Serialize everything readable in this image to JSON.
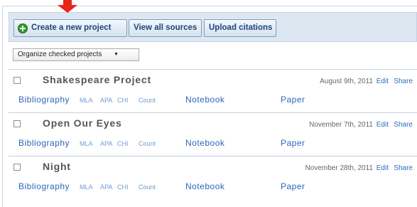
{
  "toolbar": {
    "create_label": "Create a new project",
    "view_label": "View all sources",
    "upload_label": "Upload citations"
  },
  "organize": {
    "selected": "Organize checked projects"
  },
  "projects": [
    {
      "title": "Shakespeare Project",
      "date": "August 9th, 2011",
      "edit": "Edit",
      "share": "Share",
      "bibliography": "Bibliography",
      "mla": "MLA",
      "apa": "APA",
      "chi": "CHI",
      "count": "Count",
      "notebook": "Notebook",
      "paper": "Paper"
    },
    {
      "title": "Open Our Eyes",
      "date": "November 7th, 2011",
      "edit": "Edit",
      "share": "Share",
      "bibliography": "Bibliography",
      "mla": "MLA",
      "apa": "APA",
      "chi": "CHI",
      "count": "Count",
      "notebook": "Notebook",
      "paper": "Paper"
    },
    {
      "title": "Night",
      "date": "November 28th, 2011",
      "edit": "Edit",
      "share": "Share",
      "bibliography": "Bibliography",
      "mla": "MLA",
      "apa": "APA",
      "chi": "CHI",
      "count": "Count",
      "notebook": "Notebook",
      "paper": "Paper"
    }
  ],
  "icons": {
    "create": "plus-circle-icon",
    "organize_caret": "caret-down-icon",
    "pointer": "arrow-down-icon",
    "checkbox": "checkbox-icon"
  },
  "colors": {
    "link": "#2c66b8",
    "toolbar_bg": "#dde7f2",
    "button_text": "#21457a",
    "pointer_arrow": "#e8261a",
    "plus_icon": "#2e9e2a"
  }
}
